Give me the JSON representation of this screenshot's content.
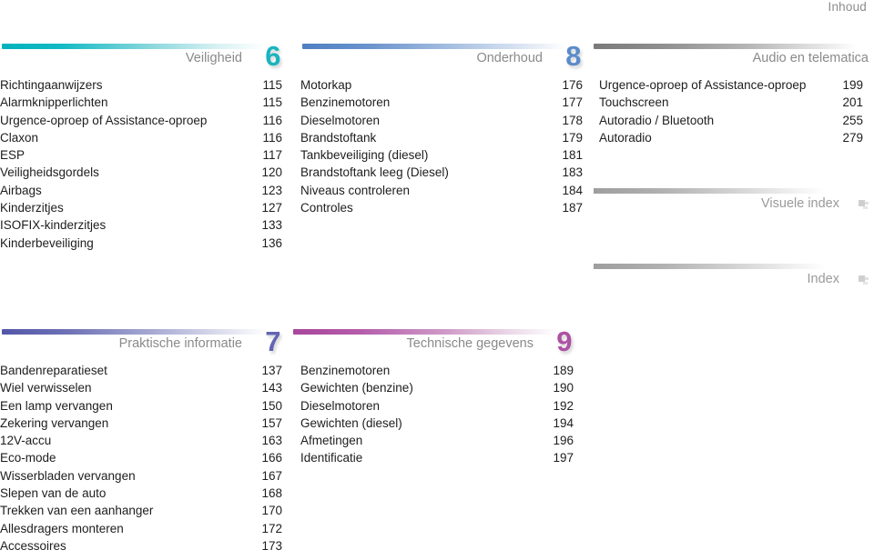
{
  "document": {
    "label": "Inhoud"
  },
  "sections": [
    {
      "id": "veiligheid",
      "title": "Veiligheid",
      "number": "6",
      "accent": "#19b4c0",
      "bar_style": "bar-teal",
      "num_style": "num-teal",
      "entries": [
        {
          "label": "Richtingaanwijzers",
          "page": "115"
        },
        {
          "label": "Alarmknipperlichten",
          "page": "115"
        },
        {
          "label": "Urgence-oproep of Assistance-oproep",
          "page": "116"
        },
        {
          "label": "Claxon",
          "page": "116"
        },
        {
          "label": "ESP",
          "page": "117"
        },
        {
          "label": "Veiligheidsgordels",
          "page": "120"
        },
        {
          "label": "Airbags",
          "page": "123"
        },
        {
          "label": "Kinderzitjes",
          "page": "127"
        },
        {
          "label": "ISOFIX-kinderzitjes",
          "page": "133"
        },
        {
          "label": "Kinderbeveiliging",
          "page": "136"
        }
      ]
    },
    {
      "id": "onderhoud",
      "title": "Onderhoud",
      "number": "8",
      "accent": "#5a8ccb",
      "bar_style": "bar-blue",
      "num_style": "num-blue",
      "entries": [
        {
          "label": "Motorkap",
          "page": "176"
        },
        {
          "label": "Benzinemotoren",
          "page": "177"
        },
        {
          "label": "Dieselmotoren",
          "page": "178"
        },
        {
          "label": "Brandstoftank",
          "page": "179"
        },
        {
          "label": "Tankbeveiliging (diesel)",
          "page": "181"
        },
        {
          "label": "Brandstoftank leeg (Diesel)",
          "page": "183"
        },
        {
          "label": "Niveaus controleren",
          "page": "184"
        },
        {
          "label": "Controles",
          "page": "187"
        }
      ]
    },
    {
      "id": "audio-en-telematica",
      "title": "Audio en telematica",
      "number": "",
      "accent": "#8e8e8e",
      "bar_style": "bar-grey",
      "num_style": "",
      "entries": [
        {
          "label": "Urgence-oproep of Assistance-oproep",
          "page": "199"
        },
        {
          "label": "Touchscreen",
          "page": "201"
        },
        {
          "label": "Autoradio / Bluetooth",
          "page": "255"
        },
        {
          "label": "Autoradio",
          "page": "279"
        }
      ]
    },
    {
      "id": "praktische-informatie",
      "title": "Praktische informatie",
      "number": "7",
      "accent": "#6165b3",
      "bar_style": "bar-indigo",
      "num_style": "num-indigo",
      "entries": [
        {
          "label": "Bandenreparatieset",
          "page": "137"
        },
        {
          "label": "Wiel verwisselen",
          "page": "143"
        },
        {
          "label": "Een lamp vervangen",
          "page": "150"
        },
        {
          "label": "Zekering vervangen",
          "page": "157"
        },
        {
          "label": "12V-accu",
          "page": "163"
        },
        {
          "label": "Eco-mode",
          "page": "166"
        },
        {
          "label": "Wisserbladen vervangen",
          "page": "167"
        },
        {
          "label": "Slepen van de auto",
          "page": "168"
        },
        {
          "label": "Trekken van een aanhanger",
          "page": "170"
        },
        {
          "label": "Allesdragers monteren",
          "page": "172"
        },
        {
          "label": "Accessoires",
          "page": "173"
        }
      ]
    },
    {
      "id": "technische-gegevens",
      "title": "Technische gegevens",
      "number": "9",
      "accent": "#ad52a4",
      "bar_style": "bar-magenta",
      "num_style": "num-magenta",
      "entries": [
        {
          "label": "Benzinemotoren",
          "page": "189"
        },
        {
          "label": "Gewichten (benzine)",
          "page": "190"
        },
        {
          "label": "Dieselmotoren",
          "page": "192"
        },
        {
          "label": "Gewichten (diesel)",
          "page": "194"
        },
        {
          "label": "Afmetingen",
          "page": "196"
        },
        {
          "label": "Identificatie",
          "page": "197"
        }
      ]
    }
  ],
  "index_links": [
    {
      "id": "visuele-index",
      "title": "Visuele index"
    },
    {
      "id": "index",
      "title": "Index"
    }
  ]
}
